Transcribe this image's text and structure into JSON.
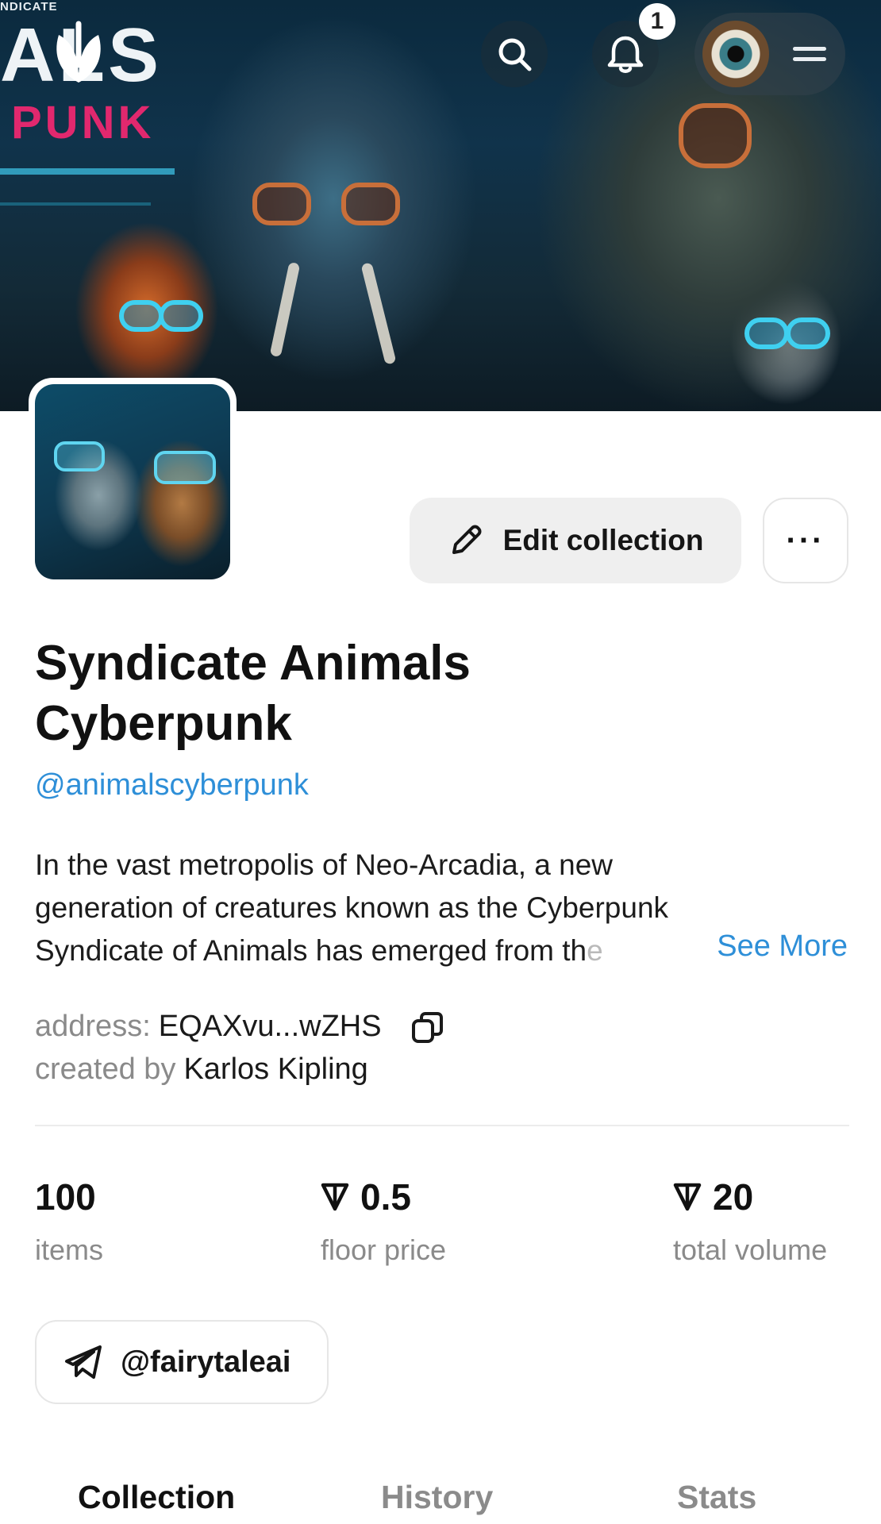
{
  "banner": {
    "wordmark_top": "NDICATE",
    "wordmark": "ALS",
    "wordmark_sub": "PUNK",
    "notification_count": "1"
  },
  "actions": {
    "edit_label": "Edit collection",
    "more_label": "···"
  },
  "collection": {
    "title_line1": "Syndicate Animals",
    "title_line2": "Cyberpunk",
    "handle": "@animalscyberpunk",
    "description_line1": "In the vast metropolis of Neo-Arcadia, a new",
    "description_line2": "generation of creatures known as the Cyberpunk",
    "description_line3": "Syndicate of Animals has emerged from th",
    "description_fade": "e",
    "see_more": "See More",
    "address_label": "address:",
    "address_value": "EQAXvu...wZHS",
    "creator_label": "created by",
    "creator_value": "Karlos Kipling"
  },
  "stats": [
    {
      "value": "100",
      "label": "items",
      "currency": ""
    },
    {
      "value": "0.5",
      "label": "floor price",
      "currency": "ton"
    },
    {
      "value": "20",
      "label": "total volume",
      "currency": "ton"
    }
  ],
  "social": {
    "telegram_handle": "@fairytaleai",
    "icon": "telegram-icon"
  },
  "tabs": [
    {
      "label": "Collection",
      "active": true
    },
    {
      "label": "History",
      "active": false
    },
    {
      "label": "Stats",
      "active": false
    }
  ],
  "colors": {
    "link": "#2e8fd8",
    "muted": "#8a8a8a",
    "button_bg": "#efefef"
  }
}
